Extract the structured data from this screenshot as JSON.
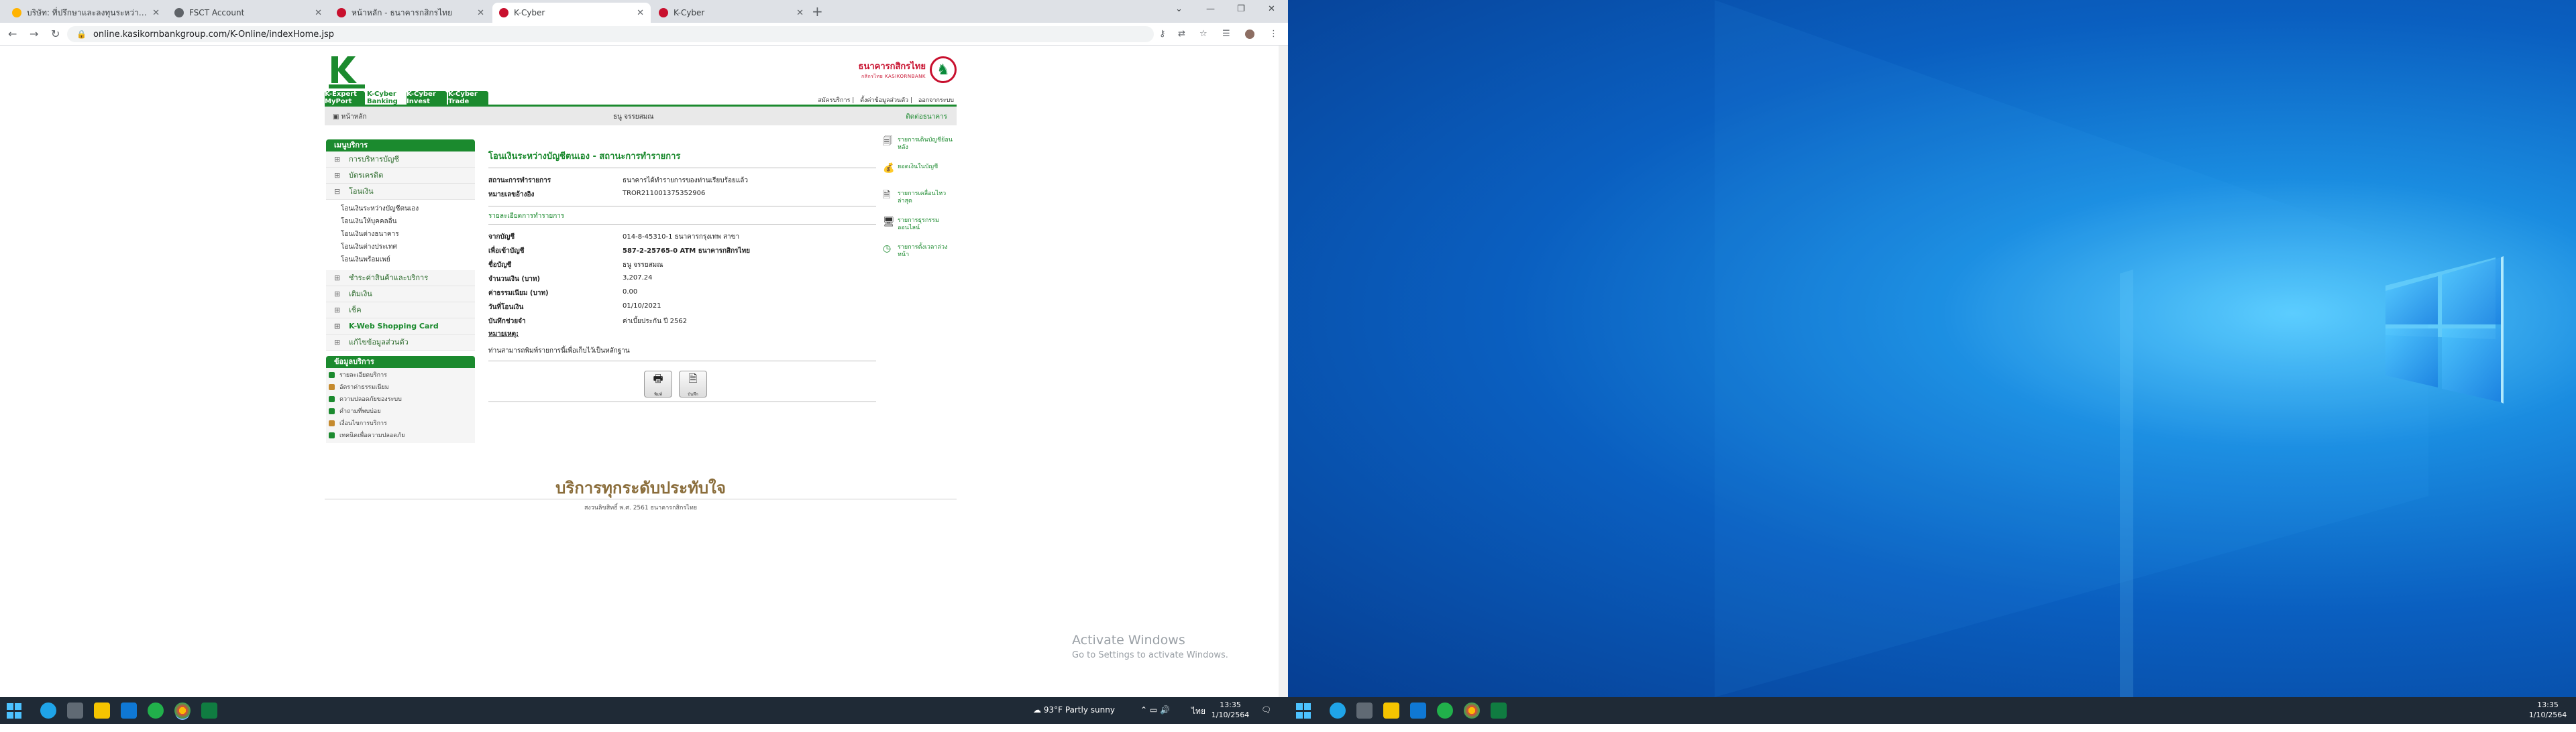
{
  "browser": {
    "tabs": [
      {
        "title": "บริษัท: ที่ปรึกษาและลงทุนระหว่างประเทศ",
        "color": "#ffb300"
      },
      {
        "title": "FSCT Account",
        "color": "#5f6368"
      },
      {
        "title": "หน้าหลัก - ธนาคารกสิกรไทย",
        "color": "#c8102e"
      },
      {
        "title": "K-Cyber",
        "color": "#c8102e"
      },
      {
        "title": "K-Cyber",
        "color": "#c8102e"
      }
    ],
    "active_tab": 3,
    "url": "online.kasikornbankgroup.com/K-Online/indexHome.jsp"
  },
  "header": {
    "logo_alt": "KASIKORNBANK",
    "bank_th": "ธนาคารกสิกรไทย",
    "bank_en": "กสิกรไทย KASIKORNBANK"
  },
  "navtabs": [
    "K-Expert MyPort",
    "K-Cyber Banking",
    "K-Cyber Invest",
    "K-Cyber Trade"
  ],
  "toplinks": [
    "สมัครบริการ",
    "ตั้งค่าข้อมูลส่วนตัว",
    "ออกจากระบบ"
  ],
  "userbar": {
    "home": "หน้าหลัก",
    "name": "ธนู จรรยสมณ",
    "logout": "ติดต่อธนาคาร"
  },
  "sidebar": {
    "menu_title": "เมนูบริการ",
    "items": [
      "การบริหารบัญชี",
      "บัตรเครดิต",
      "โอนเงิน"
    ],
    "transfer_subs": [
      "โอนเงินระหว่างบัญชีตนเอง",
      "โอนเงินให้บุคคลอื่น",
      "โอนเงินต่างธนาคาร",
      "โอนเงินต่างประเทศ",
      "โอนเงินพร้อมเพย์"
    ],
    "items2": [
      "ชำระค่าสินค้าและบริการ",
      "เติมเงิน",
      "เช็ค",
      "K-Web Shopping Card",
      "แก้ไขข้อมูลส่วนตัว"
    ],
    "info_title": "ข้อมูลบริการ",
    "info_items": [
      "รายละเอียดบริการ",
      "อัตราค่าธรรมเนียม",
      "ความปลอดภัยของระบบ",
      "คำถามที่พบบ่อย",
      "เงื่อนไขการบริการ",
      "เทคนิคเพื่อความปลอดภัย"
    ]
  },
  "main": {
    "title": "โอนเงินระหว่างบัญชีตนเอง - สถานะการทำรายการ",
    "status_label": "สถานะการทำรายการ",
    "status_value": "ธนาคารได้ทำรายการของท่านเรียบร้อยแล้ว",
    "ref_label": "หมายเลขอ้างอิง",
    "ref_value": "TROR211001375352906",
    "details_title": "รายละเอียดการทำรายการ",
    "rows": [
      {
        "k": "จากบัญชี",
        "v": "014-8-45310-1 ธนาคารกรุงเทพ สาขา",
        "bold": false
      },
      {
        "k": "เพื่อเข้าบัญชี",
        "v": "587-2-25765-0 ATM ธนาคารกสิกรไทย",
        "bold": true
      },
      {
        "k": "ชื่อบัญชี",
        "v": "ธนู จรรยสมณ",
        "bold": false
      },
      {
        "k": "จำนวนเงิน (บาท)",
        "v": "3,207.24",
        "bold": false
      },
      {
        "k": "ค่าธรรมเนียม (บาท)",
        "v": "0.00",
        "bold": false
      },
      {
        "k": "วันที่โอนเงิน",
        "v": "01/10/2021",
        "bold": false
      },
      {
        "k": "บันทึกช่วยจำ",
        "v": "ค่าเบี้ยประกัน ปี 2562",
        "bold": false
      }
    ],
    "note_title": "หมายเหตุ:",
    "note": "ท่านสามารถพิมพ์รายการนี้เพื่อเก็บไว้เป็นหลักฐาน",
    "btn_print": "พิมพ์",
    "btn_save": "บันทึก"
  },
  "right_panel": [
    "รายการเดินบัญชีย้อนหลัง",
    "ยอดเงินในบัญชี",
    "รายการเคลื่อนไหวล่าสุด",
    "รายการธุรกรรมออนไลน์",
    "รายการตั้งเวลาล่วงหน้า"
  ],
  "slogan": "บริการทุกระดับประทับใจ",
  "copyright": "สงวนลิขสิทธิ์ พ.ศ. 2561 ธนาคารกสิกรไทย",
  "activate": {
    "line1": "Activate Windows",
    "line2": "Go to Settings to activate Windows."
  },
  "taskbar_left": {
    "weather": "93°F  Partly sunny",
    "lang": "ไทย",
    "time": "13:35",
    "date": "1/10/2564"
  },
  "taskbar_right": {
    "time": "13:35",
    "date": "1/10/2564"
  },
  "colors": {
    "brand_green": "#1b8a2e",
    "brand_red": "#c8102e"
  }
}
